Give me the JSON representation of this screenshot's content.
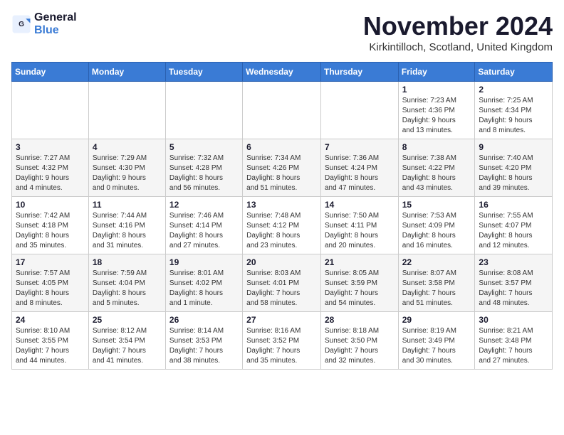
{
  "header": {
    "logo_line1": "General",
    "logo_line2": "Blue",
    "month_title": "November 2024",
    "subtitle": "Kirkintilloch, Scotland, United Kingdom"
  },
  "days_of_week": [
    "Sunday",
    "Monday",
    "Tuesday",
    "Wednesday",
    "Thursday",
    "Friday",
    "Saturday"
  ],
  "weeks": [
    [
      {
        "day": "",
        "info": ""
      },
      {
        "day": "",
        "info": ""
      },
      {
        "day": "",
        "info": ""
      },
      {
        "day": "",
        "info": ""
      },
      {
        "day": "",
        "info": ""
      },
      {
        "day": "1",
        "info": "Sunrise: 7:23 AM\nSunset: 4:36 PM\nDaylight: 9 hours\nand 13 minutes."
      },
      {
        "day": "2",
        "info": "Sunrise: 7:25 AM\nSunset: 4:34 PM\nDaylight: 9 hours\nand 8 minutes."
      }
    ],
    [
      {
        "day": "3",
        "info": "Sunrise: 7:27 AM\nSunset: 4:32 PM\nDaylight: 9 hours\nand 4 minutes."
      },
      {
        "day": "4",
        "info": "Sunrise: 7:29 AM\nSunset: 4:30 PM\nDaylight: 9 hours\nand 0 minutes."
      },
      {
        "day": "5",
        "info": "Sunrise: 7:32 AM\nSunset: 4:28 PM\nDaylight: 8 hours\nand 56 minutes."
      },
      {
        "day": "6",
        "info": "Sunrise: 7:34 AM\nSunset: 4:26 PM\nDaylight: 8 hours\nand 51 minutes."
      },
      {
        "day": "7",
        "info": "Sunrise: 7:36 AM\nSunset: 4:24 PM\nDaylight: 8 hours\nand 47 minutes."
      },
      {
        "day": "8",
        "info": "Sunrise: 7:38 AM\nSunset: 4:22 PM\nDaylight: 8 hours\nand 43 minutes."
      },
      {
        "day": "9",
        "info": "Sunrise: 7:40 AM\nSunset: 4:20 PM\nDaylight: 8 hours\nand 39 minutes."
      }
    ],
    [
      {
        "day": "10",
        "info": "Sunrise: 7:42 AM\nSunset: 4:18 PM\nDaylight: 8 hours\nand 35 minutes."
      },
      {
        "day": "11",
        "info": "Sunrise: 7:44 AM\nSunset: 4:16 PM\nDaylight: 8 hours\nand 31 minutes."
      },
      {
        "day": "12",
        "info": "Sunrise: 7:46 AM\nSunset: 4:14 PM\nDaylight: 8 hours\nand 27 minutes."
      },
      {
        "day": "13",
        "info": "Sunrise: 7:48 AM\nSunset: 4:12 PM\nDaylight: 8 hours\nand 23 minutes."
      },
      {
        "day": "14",
        "info": "Sunrise: 7:50 AM\nSunset: 4:11 PM\nDaylight: 8 hours\nand 20 minutes."
      },
      {
        "day": "15",
        "info": "Sunrise: 7:53 AM\nSunset: 4:09 PM\nDaylight: 8 hours\nand 16 minutes."
      },
      {
        "day": "16",
        "info": "Sunrise: 7:55 AM\nSunset: 4:07 PM\nDaylight: 8 hours\nand 12 minutes."
      }
    ],
    [
      {
        "day": "17",
        "info": "Sunrise: 7:57 AM\nSunset: 4:05 PM\nDaylight: 8 hours\nand 8 minutes."
      },
      {
        "day": "18",
        "info": "Sunrise: 7:59 AM\nSunset: 4:04 PM\nDaylight: 8 hours\nand 5 minutes."
      },
      {
        "day": "19",
        "info": "Sunrise: 8:01 AM\nSunset: 4:02 PM\nDaylight: 8 hours\nand 1 minute."
      },
      {
        "day": "20",
        "info": "Sunrise: 8:03 AM\nSunset: 4:01 PM\nDaylight: 7 hours\nand 58 minutes."
      },
      {
        "day": "21",
        "info": "Sunrise: 8:05 AM\nSunset: 3:59 PM\nDaylight: 7 hours\nand 54 minutes."
      },
      {
        "day": "22",
        "info": "Sunrise: 8:07 AM\nSunset: 3:58 PM\nDaylight: 7 hours\nand 51 minutes."
      },
      {
        "day": "23",
        "info": "Sunrise: 8:08 AM\nSunset: 3:57 PM\nDaylight: 7 hours\nand 48 minutes."
      }
    ],
    [
      {
        "day": "24",
        "info": "Sunrise: 8:10 AM\nSunset: 3:55 PM\nDaylight: 7 hours\nand 44 minutes."
      },
      {
        "day": "25",
        "info": "Sunrise: 8:12 AM\nSunset: 3:54 PM\nDaylight: 7 hours\nand 41 minutes."
      },
      {
        "day": "26",
        "info": "Sunrise: 8:14 AM\nSunset: 3:53 PM\nDaylight: 7 hours\nand 38 minutes."
      },
      {
        "day": "27",
        "info": "Sunrise: 8:16 AM\nSunset: 3:52 PM\nDaylight: 7 hours\nand 35 minutes."
      },
      {
        "day": "28",
        "info": "Sunrise: 8:18 AM\nSunset: 3:50 PM\nDaylight: 7 hours\nand 32 minutes."
      },
      {
        "day": "29",
        "info": "Sunrise: 8:19 AM\nSunset: 3:49 PM\nDaylight: 7 hours\nand 30 minutes."
      },
      {
        "day": "30",
        "info": "Sunrise: 8:21 AM\nSunset: 3:48 PM\nDaylight: 7 hours\nand 27 minutes."
      }
    ]
  ]
}
